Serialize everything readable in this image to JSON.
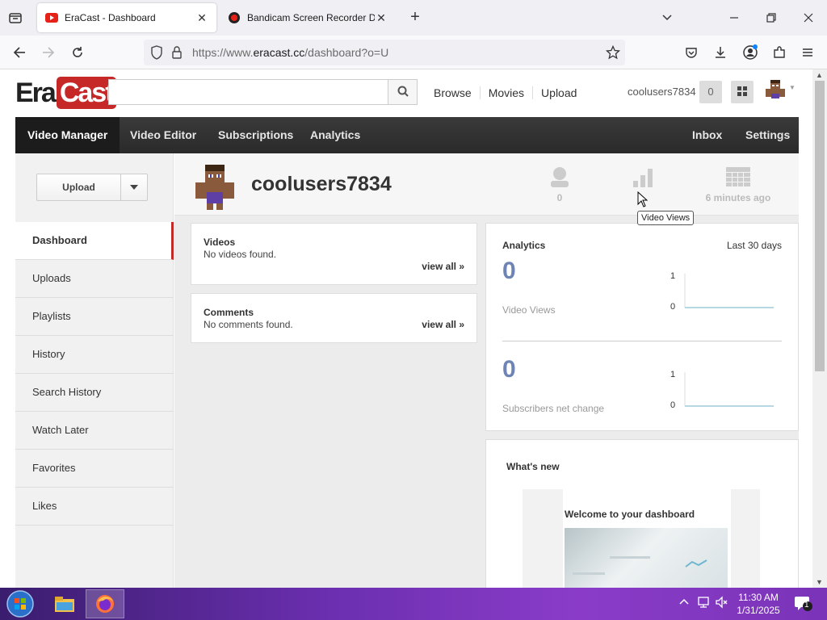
{
  "browser": {
    "tabs": [
      {
        "title": "EraCast - Dashboard",
        "active": true
      },
      {
        "title": "Bandicam Screen Recorder Dow",
        "active": false
      }
    ],
    "url": {
      "prefix": "https://www.",
      "domain": "eracast.cc",
      "path": "/dashboard?o=U"
    }
  },
  "header": {
    "logo": {
      "part1": "Era",
      "part2": "Cast"
    },
    "search": {
      "placeholder": "",
      "value": ""
    },
    "links": [
      "Browse",
      "Movies",
      "Upload"
    ],
    "username": "coolusers7834",
    "notification_count": "0"
  },
  "mainnav": {
    "left": [
      "Video Manager",
      "Video Editor",
      "Subscriptions",
      "Analytics"
    ],
    "right": [
      "Inbox",
      "Settings"
    ]
  },
  "sidebar": {
    "upload_label": "Upload",
    "items": [
      "Dashboard",
      "Uploads",
      "Playlists",
      "History",
      "Search History",
      "Watch Later",
      "Favorites",
      "Likes"
    ]
  },
  "profile": {
    "name": "coolusers7834",
    "subscribers": "0",
    "last_active": "6 minutes ago"
  },
  "cards": {
    "videos": {
      "title": "Videos",
      "body": "No videos found.",
      "link": "view all »"
    },
    "comments": {
      "title": "Comments",
      "body": "No comments found.",
      "link": "view all »"
    }
  },
  "analytics": {
    "title": "Analytics",
    "range": "Last 30 days",
    "metrics": [
      {
        "value": "0",
        "label": "Video Views",
        "axis_top": "1",
        "axis_bottom": "0"
      },
      {
        "value": "0",
        "label": "Subscribers net change",
        "axis_top": "1",
        "axis_bottom": "0"
      }
    ]
  },
  "whats_new": {
    "title": "What's new",
    "card_title": "Welcome to your dashboard"
  },
  "tooltip": "Video Views",
  "taskbar": {
    "time": "11:30 AM",
    "date": "1/31/2025",
    "notification_badge": "1"
  },
  "colors": {
    "brand_red": "#c62828",
    "metric_blue": "#6d84b4",
    "nav_dark": "#2a2a2a",
    "spark_line": "#9ecbd8"
  }
}
